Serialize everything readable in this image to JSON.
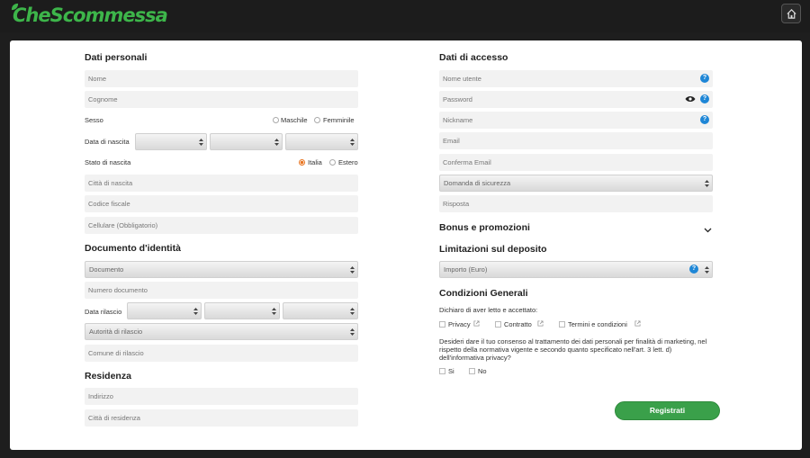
{
  "brand": {
    "logo_text": "CheScommessa",
    "accent": "#3db54a"
  },
  "header": {
    "home_icon": "home-icon"
  },
  "personal": {
    "title": "Dati personali",
    "nome_placeholder": "Nome",
    "cognome_placeholder": "Cognome",
    "sesso_label": "Sesso",
    "sesso_options": [
      "Maschile",
      "Femminile"
    ],
    "birth_label": "Data di nascita",
    "birth_state_label": "Stato di nascita",
    "birth_state_options": [
      "Italia",
      "Estero"
    ],
    "birth_state_selected": "Italia",
    "city_placeholder": "Città di nascita",
    "fiscal_placeholder": "Codice fiscale",
    "mobile_placeholder": "Cellulare (Obbligatorio)"
  },
  "identity": {
    "title": "Documento d'identità",
    "doc_select": "Documento",
    "number_placeholder": "Numero documento",
    "issue_date_label": "Data rilascio",
    "authority_select": "Autorità di rilascio",
    "issue_city_placeholder": "Comune di rilascio"
  },
  "residence": {
    "title": "Residenza",
    "address_placeholder": "Indirizzo",
    "city_placeholder": "Città di residenza"
  },
  "access": {
    "title": "Dati di accesso",
    "username_placeholder": "Nome utente",
    "password_placeholder": "Password",
    "nickname_placeholder": "Nickname",
    "email_placeholder": "Email",
    "confirm_email_placeholder": "Conferma Email",
    "question_select": "Domanda di sicurezza",
    "answer_placeholder": "Risposta"
  },
  "bonus": {
    "title": "Bonus e promozioni"
  },
  "deposit": {
    "title": "Limitazioni sul deposito",
    "amount_select": "Importo (Euro)"
  },
  "terms": {
    "title": "Condizioni Generali",
    "declare_text": "Dichiaro di aver letto e accettato:",
    "checks": [
      "Privacy",
      "Contratto",
      "Termini e condizioni"
    ],
    "consent_text": "Desideri dare il tuo consenso al trattamento dei dati personali per finalità di marketing, nel rispetto della normativa vigente e secondo quanto specificato nell'art. 3 lett. d) dell'informativa privacy?",
    "consent_options": [
      "Si",
      "No"
    ]
  },
  "submit": {
    "label": "Registrati"
  }
}
